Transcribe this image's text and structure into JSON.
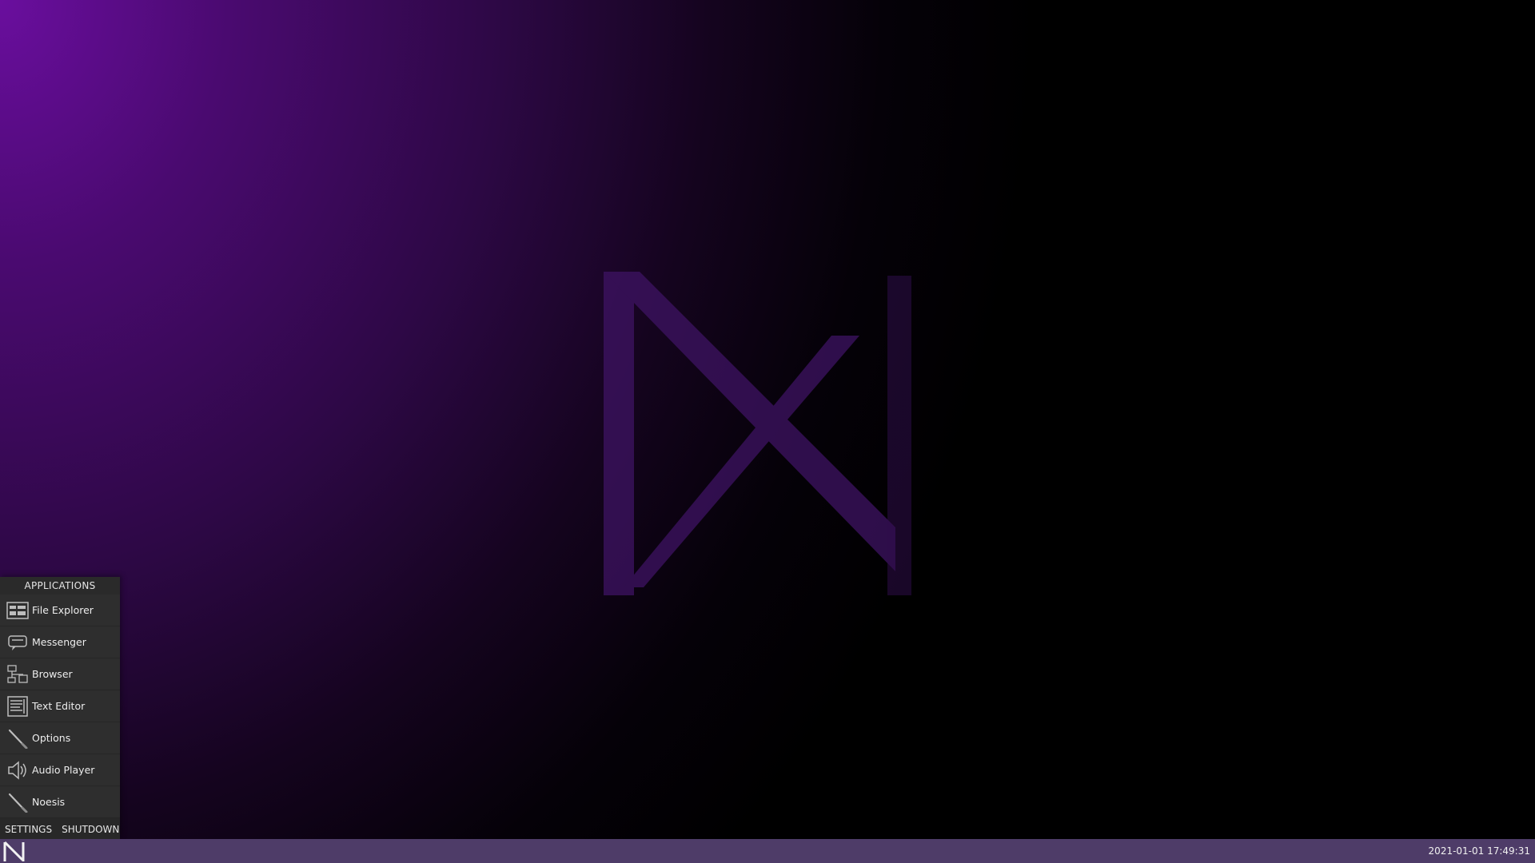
{
  "menu": {
    "title": "APPLICATIONS",
    "items": [
      {
        "label": "File Explorer",
        "icon": "file-explorer-icon"
      },
      {
        "label": "Messenger",
        "icon": "messenger-icon"
      },
      {
        "label": "Browser",
        "icon": "browser-icon"
      },
      {
        "label": "Text Editor",
        "icon": "text-editor-icon"
      },
      {
        "label": "Options",
        "icon": "options-icon"
      },
      {
        "label": "Audio Player",
        "icon": "audio-player-icon"
      },
      {
        "label": "Noesis",
        "icon": "noesis-icon"
      }
    ],
    "settings_label": "SETTINGS",
    "shutdown_label": "SHUTDOWN"
  },
  "taskbar": {
    "clock": "2021-01-01 17:49:31",
    "start_icon": "n-logo-icon"
  },
  "colors": {
    "taskbar": "#4e3c68",
    "menu_bg": "#282828",
    "wallpaper_accent": "#6a0e9e"
  }
}
